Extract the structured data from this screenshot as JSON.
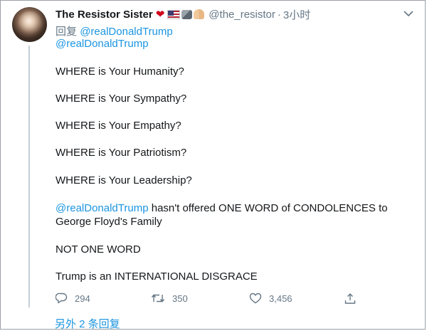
{
  "tweet": {
    "display_name": "The Resistor Sister",
    "name_emoji": [
      "heart-icon",
      "us-flag-icon",
      "flexed-arm-icon",
      "folded-hands-icon"
    ],
    "handle": "@the_resistor",
    "separator": "·",
    "time": "3小时",
    "reply_prefix": "回复",
    "reply_to": "@realDonaldTrump",
    "body": {
      "mention": "@realDonaldTrump",
      "line1": "WHERE is Your Humanity?",
      "line2": "WHERE is Your Sympathy?",
      "line3": "WHERE is Your Empathy?",
      "line4": "WHERE is Your Patriotism?",
      "line5": "WHERE is Your Leadership?",
      "line6_mention": "@realDonaldTrump",
      "line6_rest": " hasn't offered ONE WORD of CONDOLENCES to",
      "line7": "George Floyd's Family",
      "line8": "NOT ONE WORD",
      "line9": "Trump is an INTERNATIONAL DISGRACE"
    },
    "actions": {
      "reply_count": "294",
      "retweet_count": "350",
      "like_count": "3,456"
    },
    "more_replies": "另外 2 条回复"
  },
  "colors": {
    "link": "#1b95e0",
    "secondary_text": "#657786",
    "primary_text": "#14171a",
    "thread_line": "#c4cfd6",
    "heart": "#d0021b"
  }
}
